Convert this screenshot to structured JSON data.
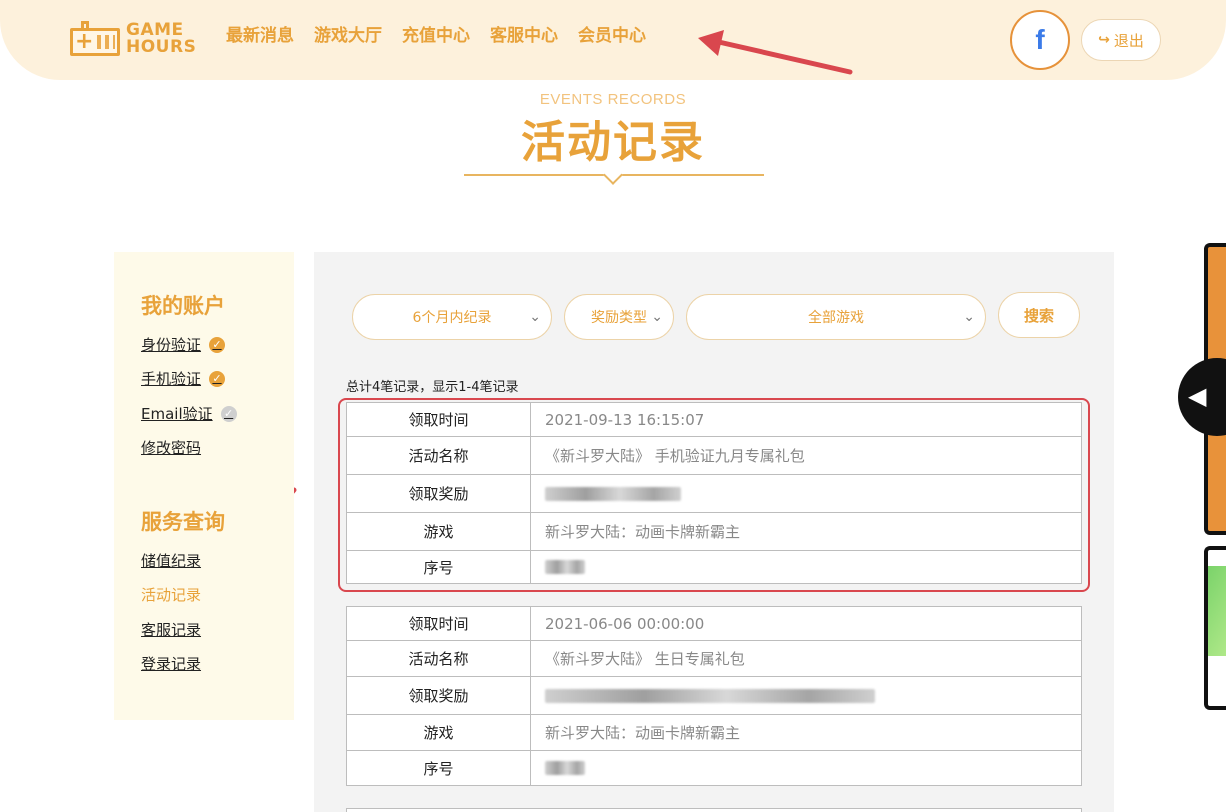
{
  "brand": {
    "name_line1": "GAME",
    "name_line2": "HOURS"
  },
  "nav": [
    "最新消息",
    "游戏大厅",
    "充值中心",
    "客服中心",
    "会员中心"
  ],
  "header": {
    "facebook_icon": "f",
    "logout_label": "退出"
  },
  "page": {
    "subtitle": "EVENTS RECORDS",
    "title": "活动记录"
  },
  "sidebar": {
    "account_heading": "我的账户",
    "account_items": [
      {
        "label": "身份验证",
        "verified": true
      },
      {
        "label": "手机验证",
        "verified": true
      },
      {
        "label": "Email验证",
        "verified": false
      },
      {
        "label": "修改密码"
      }
    ],
    "service_heading": "服务查询",
    "service_items": [
      "储值纪录",
      "活动记录",
      "客服记录",
      "登录记录"
    ]
  },
  "filters": {
    "period": "6个月内纪录",
    "reward_type": "奖励类型",
    "game": "全部游戏",
    "search_label": "搜索"
  },
  "summary": "总计4笔记录，显示1-4笔记录",
  "labels": {
    "time": "领取时间",
    "event": "活动名称",
    "reward": "领取奖励",
    "game": "游戏",
    "serial": "序号"
  },
  "records": [
    {
      "time": "2021-09-13 16:15:07",
      "event": "《新斗罗大陆》 手机验证九月专属礼包",
      "game": "新斗罗大陆：动画卡牌新霸主"
    },
    {
      "time": "2021-06-06 00:00:00",
      "event": "《新斗罗大陆》 生日专属礼包",
      "game": "新斗罗大陆：动画卡牌新霸主"
    }
  ],
  "colors": {
    "accent": "#e8a23a",
    "header_bg": "#fdf1dc",
    "highlight": "#d9474e"
  }
}
